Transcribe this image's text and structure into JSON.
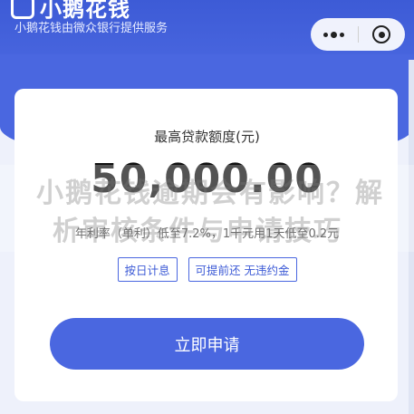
{
  "header": {
    "logo_text": "小鹅花钱",
    "subtitle": "小鹅花钱由微众银行提供服务"
  },
  "capsule": {
    "more_icon": "more-dots-icon",
    "close_icon": "target-close-icon"
  },
  "card": {
    "title": "最高贷款额度(元)",
    "amount": "50,000.00",
    "rate_text": "年利率（单利）低至7.2%，1千元用1天低至0.2元",
    "tags": [
      "按日计息",
      "可提前还 无违约金"
    ],
    "apply_button": "立即申请"
  },
  "watermark": {
    "line1": "小鹅花钱逾期会有影响？解",
    "line2": "析审核条件与申请技巧"
  },
  "colors": {
    "brand_blue": "#4a67e0",
    "header_blue": "#3d5bd6",
    "background": "#eef1fb"
  }
}
